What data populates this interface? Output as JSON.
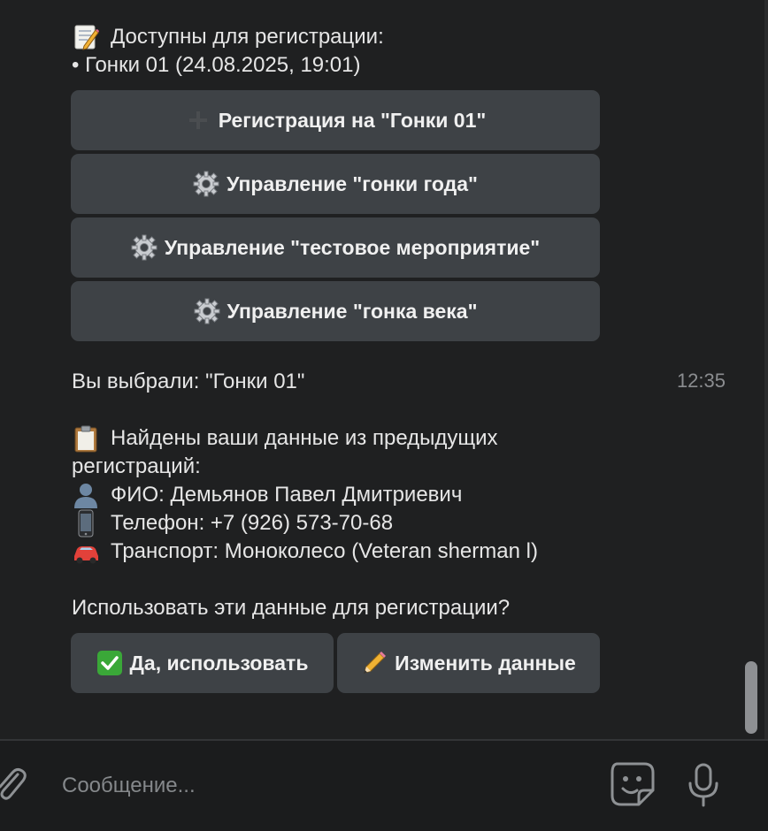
{
  "message1": {
    "header": "Доступны для регистрации:",
    "item": "• Гонки 01 (24.08.2025, 19:01)"
  },
  "buttons": [
    {
      "label": "Регистрация на \"Гонки 01\"",
      "icon": "plus-icon"
    },
    {
      "label": "Управление \"гонки года\"",
      "icon": "gear-icon"
    },
    {
      "label": "Управление \"тестовое мероприятие\"",
      "icon": "gear-icon"
    },
    {
      "label": "Управление \"гонка века\"",
      "icon": "gear-icon"
    }
  ],
  "message2": {
    "text": "Вы выбрали: \"Гонки 01\"",
    "time": "12:35"
  },
  "message3": {
    "line1": "Найдены ваши данные из предыдущих",
    "line2": "регистраций:",
    "name": "ФИО: Демьянов Павел Дмитриевич",
    "phone": "Телефон: +7 (926) 573-70-68",
    "transport": "Транспорт: Моноколесо (Veteran sherman l)",
    "question": "Использовать эти данные для регистрации?"
  },
  "reply_buttons": [
    {
      "label": "Да, использовать",
      "icon": "check-icon"
    },
    {
      "label": "Изменить данные",
      "icon": "pencil-icon"
    }
  ],
  "composer": {
    "placeholder": "Сообщение..."
  },
  "colors": {
    "background": "#1f2021",
    "button": "#3e4246",
    "text": "#e6e6e6",
    "muted": "#8b8d90"
  }
}
